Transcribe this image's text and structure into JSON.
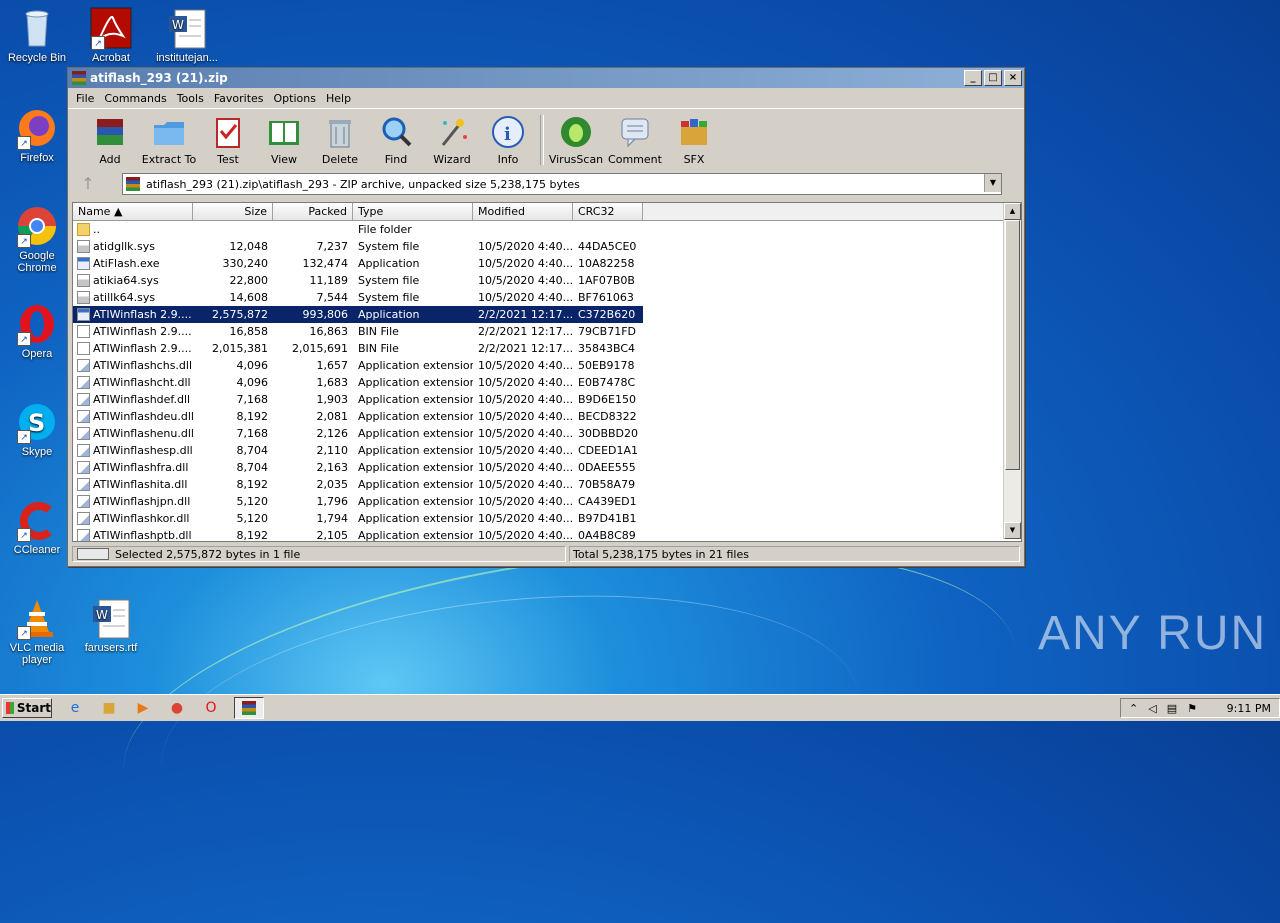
{
  "desktop": {
    "icons": [
      {
        "label": "Recycle Bin"
      },
      {
        "label": "Acrobat"
      },
      {
        "label": "institutejan..."
      },
      {
        "label": "Firefox"
      },
      {
        "label": "Google Chrome"
      },
      {
        "label": "Opera"
      },
      {
        "label": "Skype"
      },
      {
        "label": "CCleaner"
      },
      {
        "label": "VLC media player"
      },
      {
        "label": "farusers.rtf"
      }
    ],
    "watermark": "ANY RUN"
  },
  "window": {
    "title": "atiflash_293 (21).zip",
    "menu": [
      "File",
      "Commands",
      "Tools",
      "Favorites",
      "Options",
      "Help"
    ],
    "toolbar": [
      {
        "label": "Add",
        "icon": "add-archive-icon"
      },
      {
        "label": "Extract To",
        "icon": "extract-folder-icon"
      },
      {
        "label": "Test",
        "icon": "test-clipboard-icon"
      },
      {
        "label": "View",
        "icon": "view-book-icon"
      },
      {
        "label": "Delete",
        "icon": "trash-icon"
      },
      {
        "label": "Find",
        "icon": "magnifier-icon"
      },
      {
        "label": "Wizard",
        "icon": "wand-icon"
      },
      {
        "label": "Info",
        "icon": "info-icon"
      },
      {
        "label": "VirusScan",
        "icon": "bug-icon"
      },
      {
        "label": "Comment",
        "icon": "comment-icon"
      },
      {
        "label": "SFX",
        "icon": "sfx-box-icon"
      }
    ],
    "address": "atiflash_293 (21).zip\\atiflash_293 - ZIP archive, unpacked size 5,238,175 bytes",
    "columns": [
      "Name",
      "Size",
      "Packed",
      "Type",
      "Modified",
      "CRC32"
    ],
    "rows": [
      {
        "name": "..",
        "size": "",
        "packed": "",
        "type": "File folder",
        "modified": "",
        "crc": "",
        "kind": "folder"
      },
      {
        "name": "atidgllk.sys",
        "size": "12,048",
        "packed": "7,237",
        "type": "System file",
        "modified": "10/5/2020 4:40...",
        "crc": "44DA5CE0",
        "kind": "sys"
      },
      {
        "name": "AtiFlash.exe",
        "size": "330,240",
        "packed": "132,474",
        "type": "Application",
        "modified": "10/5/2020 4:40...",
        "crc": "10A82258",
        "kind": "exe"
      },
      {
        "name": "atikia64.sys",
        "size": "22,800",
        "packed": "11,189",
        "type": "System file",
        "modified": "10/5/2020 4:40...",
        "crc": "1AF07B0B",
        "kind": "sys"
      },
      {
        "name": "atillk64.sys",
        "size": "14,608",
        "packed": "7,544",
        "type": "System file",
        "modified": "10/5/2020 4:40...",
        "crc": "BF761063",
        "kind": "sys"
      },
      {
        "name": "ATIWinflash 2.9....",
        "size": "2,575,872",
        "packed": "993,806",
        "type": "Application",
        "modified": "2/2/2021 12:17...",
        "crc": "C372B620",
        "kind": "exe",
        "selected": true
      },
      {
        "name": "ATIWinflash 2.9....",
        "size": "16,858",
        "packed": "16,863",
        "type": "BIN File",
        "modified": "2/2/2021 12:17...",
        "crc": "79CB71FD",
        "kind": "file"
      },
      {
        "name": "ATIWinflash 2.9....",
        "size": "2,015,381",
        "packed": "2,015,691",
        "type": "BIN File",
        "modified": "2/2/2021 12:17...",
        "crc": "35843BC4",
        "kind": "file"
      },
      {
        "name": "ATIWinflashchs.dll",
        "size": "4,096",
        "packed": "1,657",
        "type": "Application extension",
        "modified": "10/5/2020 4:40...",
        "crc": "50EB9178",
        "kind": "dll"
      },
      {
        "name": "ATIWinflashcht.dll",
        "size": "4,096",
        "packed": "1,683",
        "type": "Application extension",
        "modified": "10/5/2020 4:40...",
        "crc": "E0B7478C",
        "kind": "dll"
      },
      {
        "name": "ATIWinflashdef.dll",
        "size": "7,168",
        "packed": "1,903",
        "type": "Application extension",
        "modified": "10/5/2020 4:40...",
        "crc": "B9D6E150",
        "kind": "dll"
      },
      {
        "name": "ATIWinflashdeu.dll",
        "size": "8,192",
        "packed": "2,081",
        "type": "Application extension",
        "modified": "10/5/2020 4:40...",
        "crc": "BECD8322",
        "kind": "dll"
      },
      {
        "name": "ATIWinflashenu.dll",
        "size": "7,168",
        "packed": "2,126",
        "type": "Application extension",
        "modified": "10/5/2020 4:40...",
        "crc": "30DBBD20",
        "kind": "dll"
      },
      {
        "name": "ATIWinflashesp.dll",
        "size": "8,704",
        "packed": "2,110",
        "type": "Application extension",
        "modified": "10/5/2020 4:40...",
        "crc": "CDEED1A1",
        "kind": "dll"
      },
      {
        "name": "ATIWinflashfra.dll",
        "size": "8,704",
        "packed": "2,163",
        "type": "Application extension",
        "modified": "10/5/2020 4:40...",
        "crc": "0DAEE555",
        "kind": "dll"
      },
      {
        "name": "ATIWinflashita.dll",
        "size": "8,192",
        "packed": "2,035",
        "type": "Application extension",
        "modified": "10/5/2020 4:40...",
        "crc": "70B58A79",
        "kind": "dll"
      },
      {
        "name": "ATIWinflashjpn.dll",
        "size": "5,120",
        "packed": "1,796",
        "type": "Application extension",
        "modified": "10/5/2020 4:40...",
        "crc": "CA439ED1",
        "kind": "dll"
      },
      {
        "name": "ATIWinflashkor.dll",
        "size": "5,120",
        "packed": "1,794",
        "type": "Application extension",
        "modified": "10/5/2020 4:40...",
        "crc": "B97D41B1",
        "kind": "dll"
      },
      {
        "name": "ATIWinflashptb.dll",
        "size": "8,192",
        "packed": "2,105",
        "type": "Application extension",
        "modified": "10/5/2020 4:40...",
        "crc": "0A4B8C89",
        "kind": "dll"
      }
    ],
    "status_left": "Selected 2,575,872 bytes in 1 file",
    "status_right": "Total 5,238,175 bytes in 21 files"
  },
  "taskbar": {
    "start_label": "Start",
    "clock": "9:11 PM"
  },
  "colors": {
    "selection": "#0a246a",
    "titlebar": "#5a7fb0"
  }
}
